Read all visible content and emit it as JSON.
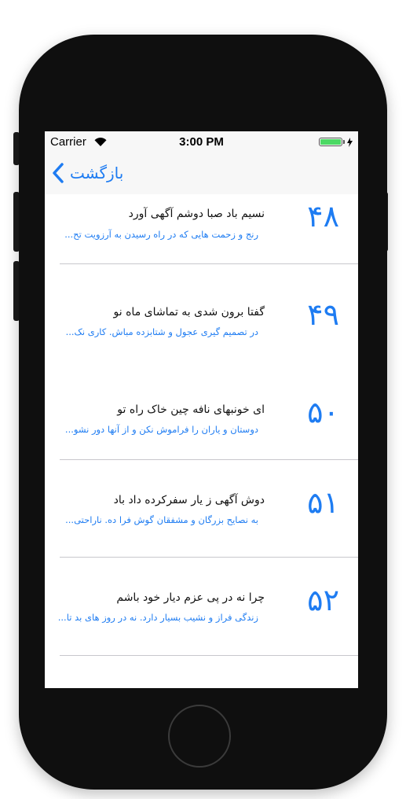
{
  "status_bar": {
    "carrier": "Carrier",
    "time": "3:00 PM",
    "battery_level": 1.0
  },
  "nav": {
    "back_label": "بازگشت"
  },
  "items": [
    {
      "number": "۴۸",
      "title": "نسیم باد صبا دوشم آگهی آورد",
      "subtitle": "رنج و زحمت هایی که در راه رسیدن به آرزویت تح..."
    },
    {
      "number": "۴۹",
      "title": "گفتا برون شدی به تماشای ماه نو",
      "subtitle": "در تصمیم گیری عجول و شتابزده مباش. کاری نک..."
    },
    {
      "number": "۵۰",
      "title": "ای خونبهای نافه چین خاک راه تو",
      "subtitle": "دوستان و یاران را فراموش نکن و از آنها دور نشو..."
    },
    {
      "number": "۵۱",
      "title": "دوش آگهی ز یار سفرکرده داد باد",
      "subtitle": "به نصایح بزرگان و مشفقان گوش فرا ده. ناراحتی..."
    },
    {
      "number": "۵۲",
      "title": "چرا نه در پی عزم دیار خود باشم",
      "subtitle": "زندگی فراز و نشیب بسیار دارد. نه در روز های بد تا..."
    }
  ],
  "colors": {
    "accent": "#1e7cf2",
    "bar_background": "#f7f7f7",
    "battery": "#4cd964",
    "device": "#0f0f0f"
  }
}
